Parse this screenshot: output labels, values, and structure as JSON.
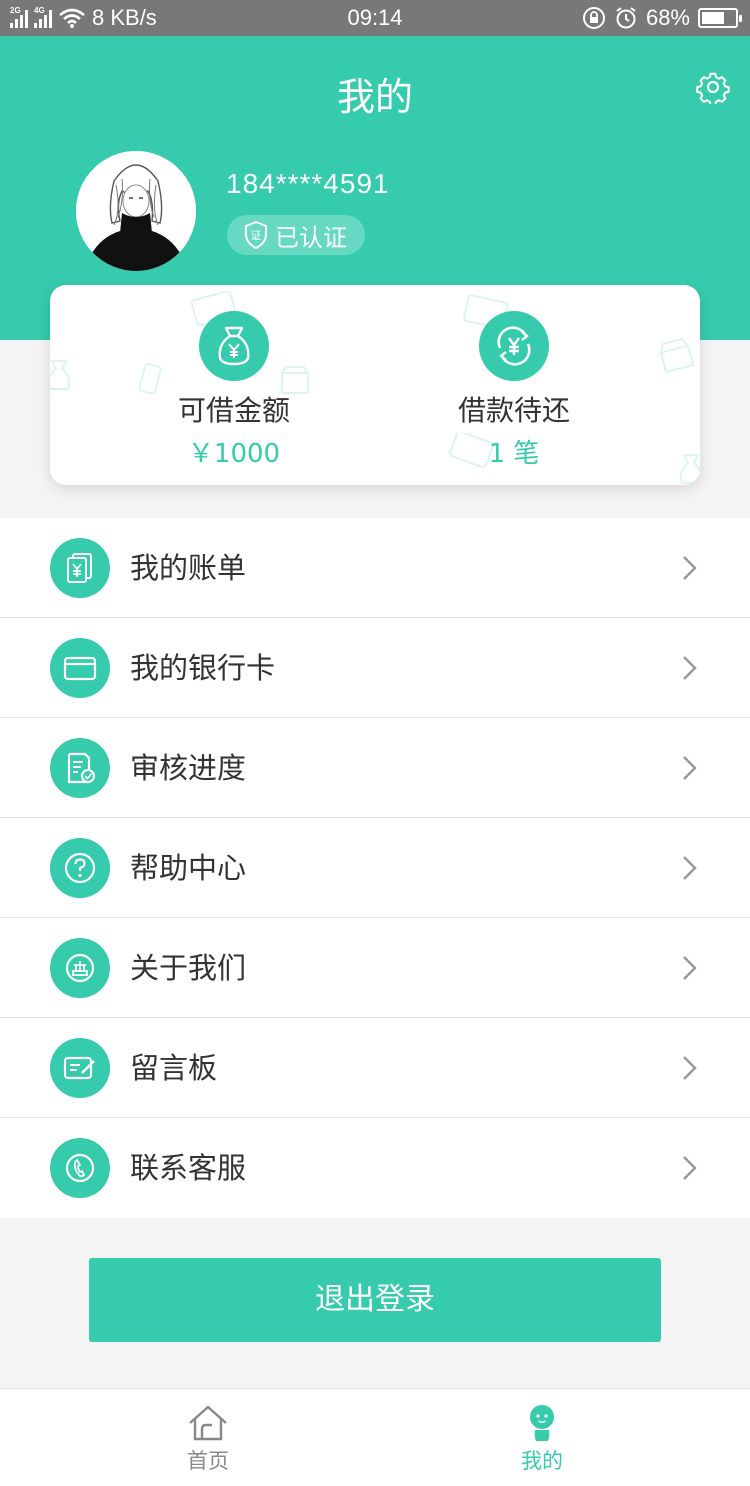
{
  "status_bar": {
    "sig1_label": "2G",
    "sig2_label": "4G",
    "net_speed": "8 KB/s",
    "time": "09:14",
    "battery": "68%",
    "battery_level": 0.68
  },
  "header": {
    "title": "我的"
  },
  "profile": {
    "phone": "184****4591",
    "verified_badge_icon_text": "证",
    "verified_label": "已认证"
  },
  "summary": {
    "available": {
      "label": "可借金额",
      "value": "￥1000",
      "icon": "money-bag-icon"
    },
    "pending": {
      "label": "借款待还",
      "value": "1 笔",
      "icon": "yen-cycle-icon"
    }
  },
  "menu": {
    "items": [
      {
        "label": "我的账单",
        "icon": "bill-icon"
      },
      {
        "label": "我的银行卡",
        "icon": "bank-card-icon"
      },
      {
        "label": "审核进度",
        "icon": "review-progress-icon"
      },
      {
        "label": "帮助中心",
        "icon": "help-icon"
      },
      {
        "label": "关于我们",
        "icon": "about-icon"
      },
      {
        "label": "留言板",
        "icon": "message-board-icon"
      },
      {
        "label": "联系客服",
        "icon": "phone-icon"
      }
    ]
  },
  "logout": {
    "label": "退出登录"
  },
  "tabbar": {
    "home": {
      "label": "首页",
      "active": false
    },
    "mine": {
      "label": "我的",
      "active": true
    }
  },
  "colors": {
    "accent": "#35cbac",
    "status_bar": "#787878",
    "text": "#333333",
    "tab_inactive": "#888888"
  }
}
